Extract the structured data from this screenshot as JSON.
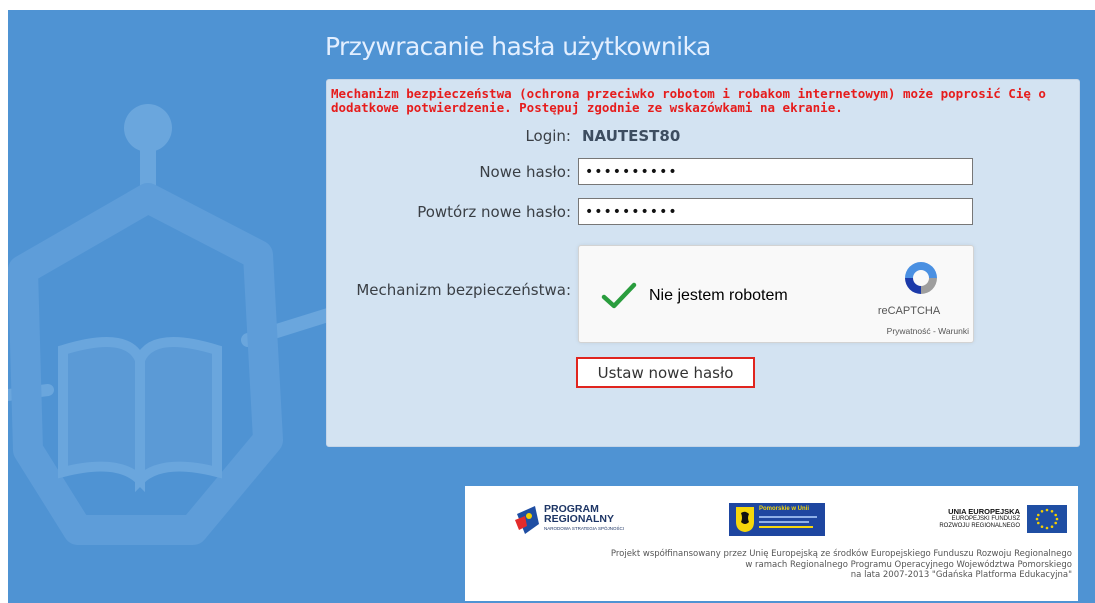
{
  "page": {
    "title": "Przywracanie hasła użytkownika"
  },
  "form": {
    "warning": "Mechanizm bezpieczeństwa (ochrona przeciwko robotom i robakom internetowym) może poprosić Cię o dodatkowe potwierdzenie. Postępuj zgodnie ze wskazówkami na ekranie.",
    "login_label": "Login:",
    "login_value": "NAUTEST80",
    "new_password_label": "Nowe hasło:",
    "new_password_value": "••••••••••",
    "repeat_password_label": "Powtórz nowe hasło:",
    "repeat_password_value": "••••••••••",
    "captcha_label": "Mechanizm bezpieczeństwa:",
    "submit_label": "Ustaw nowe hasło"
  },
  "captcha": {
    "checkbox_label": "Nie jestem robotem",
    "brand": "reCAPTCHA",
    "links": "Prywatność - Warunki",
    "checked": true,
    "check_icon": "green-checkmark-icon",
    "logo_icon": "recaptcha-logo-icon"
  },
  "footer": {
    "program_logo": [
      "PROGRAM",
      "REGIONALNY"
    ],
    "program_logo_sub": "NARODOWA STRATEGIA SPÓJNOŚCI",
    "pomorskie_logo": "Pomorskie w Unii",
    "ue_logo_title": "UNIA EUROPEJSKA",
    "ue_logo_sub": [
      "EUROPEJSKI FUNDUSZ",
      "ROZWOJU REGIONALNEGO"
    ],
    "text_lines": [
      "Projekt współfinansowany przez Unię Europejską ze środków Europejskiego Funduszu Rozwoju Regionalnego",
      "w ramach Regionalnego Programu Operacyjnego Województwa Pomorskiego",
      "na lata 2007-2013 \"Gdańska Platforma Edukacyjna\""
    ]
  },
  "colors": {
    "background": "#4f93d3",
    "panel": "#d3e3f2",
    "warning": "#e61c1c",
    "submit_border": "#e0251f",
    "check": "#2a9d3e"
  }
}
